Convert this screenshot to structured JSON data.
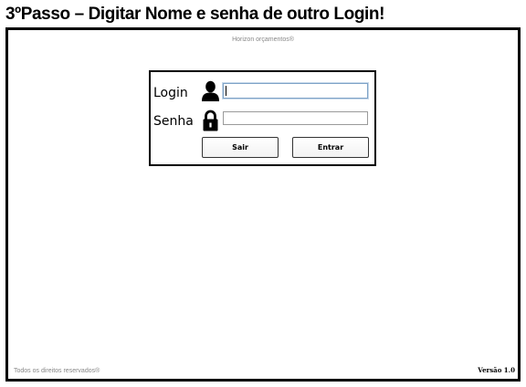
{
  "header": {
    "title": "3ºPasso – Digitar Nome e senha de outro Login!"
  },
  "app": {
    "name": "Horizon orçamentos®"
  },
  "login_form": {
    "login_label": "Login",
    "login_icon": "user-icon",
    "login_value": "",
    "senha_label": "Senha",
    "senha_icon": "lock-icon",
    "senha_value": "",
    "sair_label": "Sair",
    "entrar_label": "Entrar"
  },
  "footer": {
    "rights": "Todos os direitos reservados®",
    "version": "Versão 1.0"
  }
}
